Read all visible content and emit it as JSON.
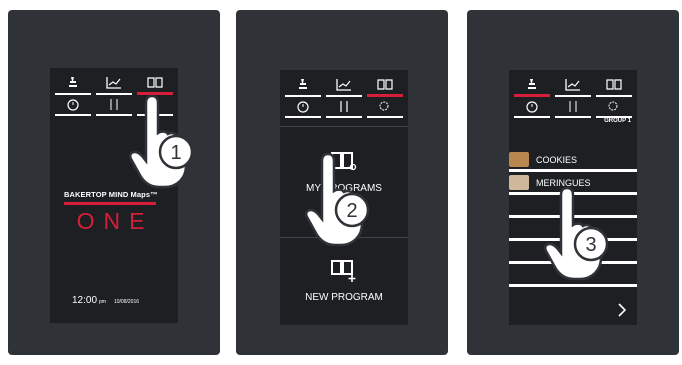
{
  "colors": {
    "panel": "#2f3338",
    "screen": "#1d1f22",
    "accent": "#d41e3a",
    "text": "#ffffff"
  },
  "tabs": {
    "top": [
      "manual-baking-icon",
      "chart-icon",
      "book-icon"
    ],
    "bottom": [
      "timer-icon",
      "steps-icon",
      "settings-icon"
    ]
  },
  "screen1": {
    "brand": "BAKERTOP MIND Maps™",
    "model": "ONE",
    "time": "12:00",
    "ampm": "pm",
    "date": "10/08/2016",
    "step": "1"
  },
  "screen2": {
    "my_programs": "MY PROGRAMS",
    "new_program": "NEW PROGRAM",
    "step": "2"
  },
  "screen3": {
    "group": "GROUP 1",
    "items": [
      {
        "label": "COOKIES",
        "thumb_color": "#b8864f"
      },
      {
        "label": "MERINGUES",
        "thumb_color": "#cfb79c"
      }
    ],
    "step": "3"
  }
}
